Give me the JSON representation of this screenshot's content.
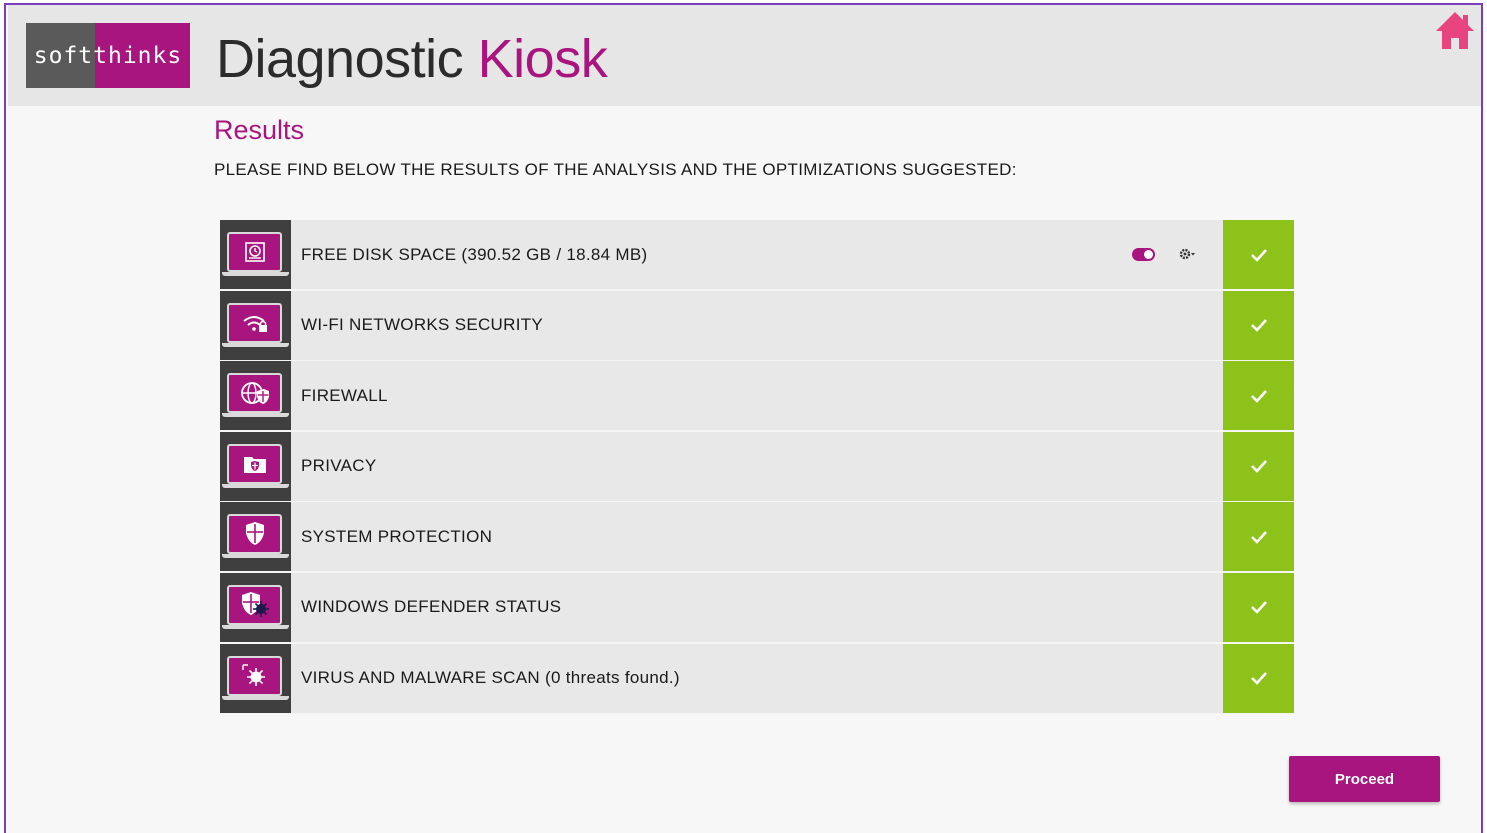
{
  "header": {
    "logo_text": "softthinks",
    "title_part1": "Diagnostic",
    "title_part2": "Kiosk"
  },
  "main": {
    "heading": "Results",
    "subtitle": "PLEASE FIND BELOW THE RESULTS OF THE ANALYSIS AND THE OPTIMIZATIONS SUGGESTED:",
    "items": [
      {
        "label": "FREE DISK SPACE (390.52 GB / 18.84 MB)",
        "icon": "disk-cleanup-icon",
        "status": "check"
      },
      {
        "label": "WI-FI NETWORKS SECURITY",
        "icon": "wifi-lock-icon",
        "status": "check"
      },
      {
        "label": "FIREWALL",
        "icon": "globe-shield-icon",
        "status": "check"
      },
      {
        "label": "PRIVACY",
        "icon": "folder-shield-icon",
        "status": "check"
      },
      {
        "label": "SYSTEM PROTECTION",
        "icon": "shield-icon",
        "status": "check"
      },
      {
        "label": "WINDOWS DEFENDER STATUS",
        "icon": "shield-virus-icon",
        "status": "check"
      },
      {
        "label": "VIRUS AND MALWARE SCAN (0 threats found.)",
        "icon": "virus-scan-icon",
        "status": "check"
      }
    ],
    "proceed_label": "Proceed"
  },
  "colors": {
    "brand": "#a8157e",
    "success": "#8cc21a",
    "frame": "#7a3fb8",
    "home": "#e8447e"
  }
}
